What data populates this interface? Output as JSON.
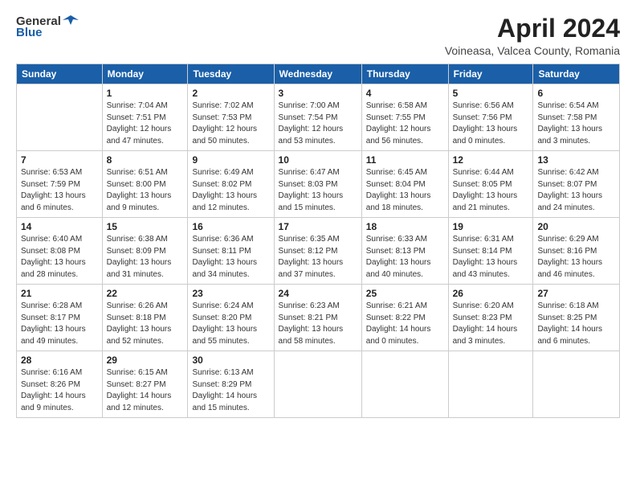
{
  "header": {
    "logo_general": "General",
    "logo_blue": "Blue",
    "title": "April 2024",
    "subtitle": "Voineasa, Valcea County, Romania"
  },
  "calendar": {
    "columns": [
      "Sunday",
      "Monday",
      "Tuesday",
      "Wednesday",
      "Thursday",
      "Friday",
      "Saturday"
    ],
    "weeks": [
      [
        {
          "day": "",
          "info": ""
        },
        {
          "day": "1",
          "info": "Sunrise: 7:04 AM\nSunset: 7:51 PM\nDaylight: 12 hours\nand 47 minutes."
        },
        {
          "day": "2",
          "info": "Sunrise: 7:02 AM\nSunset: 7:53 PM\nDaylight: 12 hours\nand 50 minutes."
        },
        {
          "day": "3",
          "info": "Sunrise: 7:00 AM\nSunset: 7:54 PM\nDaylight: 12 hours\nand 53 minutes."
        },
        {
          "day": "4",
          "info": "Sunrise: 6:58 AM\nSunset: 7:55 PM\nDaylight: 12 hours\nand 56 minutes."
        },
        {
          "day": "5",
          "info": "Sunrise: 6:56 AM\nSunset: 7:56 PM\nDaylight: 13 hours\nand 0 minutes."
        },
        {
          "day": "6",
          "info": "Sunrise: 6:54 AM\nSunset: 7:58 PM\nDaylight: 13 hours\nand 3 minutes."
        }
      ],
      [
        {
          "day": "7",
          "info": "Sunrise: 6:53 AM\nSunset: 7:59 PM\nDaylight: 13 hours\nand 6 minutes."
        },
        {
          "day": "8",
          "info": "Sunrise: 6:51 AM\nSunset: 8:00 PM\nDaylight: 13 hours\nand 9 minutes."
        },
        {
          "day": "9",
          "info": "Sunrise: 6:49 AM\nSunset: 8:02 PM\nDaylight: 13 hours\nand 12 minutes."
        },
        {
          "day": "10",
          "info": "Sunrise: 6:47 AM\nSunset: 8:03 PM\nDaylight: 13 hours\nand 15 minutes."
        },
        {
          "day": "11",
          "info": "Sunrise: 6:45 AM\nSunset: 8:04 PM\nDaylight: 13 hours\nand 18 minutes."
        },
        {
          "day": "12",
          "info": "Sunrise: 6:44 AM\nSunset: 8:05 PM\nDaylight: 13 hours\nand 21 minutes."
        },
        {
          "day": "13",
          "info": "Sunrise: 6:42 AM\nSunset: 8:07 PM\nDaylight: 13 hours\nand 24 minutes."
        }
      ],
      [
        {
          "day": "14",
          "info": "Sunrise: 6:40 AM\nSunset: 8:08 PM\nDaylight: 13 hours\nand 28 minutes."
        },
        {
          "day": "15",
          "info": "Sunrise: 6:38 AM\nSunset: 8:09 PM\nDaylight: 13 hours\nand 31 minutes."
        },
        {
          "day": "16",
          "info": "Sunrise: 6:36 AM\nSunset: 8:11 PM\nDaylight: 13 hours\nand 34 minutes."
        },
        {
          "day": "17",
          "info": "Sunrise: 6:35 AM\nSunset: 8:12 PM\nDaylight: 13 hours\nand 37 minutes."
        },
        {
          "day": "18",
          "info": "Sunrise: 6:33 AM\nSunset: 8:13 PM\nDaylight: 13 hours\nand 40 minutes."
        },
        {
          "day": "19",
          "info": "Sunrise: 6:31 AM\nSunset: 8:14 PM\nDaylight: 13 hours\nand 43 minutes."
        },
        {
          "day": "20",
          "info": "Sunrise: 6:29 AM\nSunset: 8:16 PM\nDaylight: 13 hours\nand 46 minutes."
        }
      ],
      [
        {
          "day": "21",
          "info": "Sunrise: 6:28 AM\nSunset: 8:17 PM\nDaylight: 13 hours\nand 49 minutes."
        },
        {
          "day": "22",
          "info": "Sunrise: 6:26 AM\nSunset: 8:18 PM\nDaylight: 13 hours\nand 52 minutes."
        },
        {
          "day": "23",
          "info": "Sunrise: 6:24 AM\nSunset: 8:20 PM\nDaylight: 13 hours\nand 55 minutes."
        },
        {
          "day": "24",
          "info": "Sunrise: 6:23 AM\nSunset: 8:21 PM\nDaylight: 13 hours\nand 58 minutes."
        },
        {
          "day": "25",
          "info": "Sunrise: 6:21 AM\nSunset: 8:22 PM\nDaylight: 14 hours\nand 0 minutes."
        },
        {
          "day": "26",
          "info": "Sunrise: 6:20 AM\nSunset: 8:23 PM\nDaylight: 14 hours\nand 3 minutes."
        },
        {
          "day": "27",
          "info": "Sunrise: 6:18 AM\nSunset: 8:25 PM\nDaylight: 14 hours\nand 6 minutes."
        }
      ],
      [
        {
          "day": "28",
          "info": "Sunrise: 6:16 AM\nSunset: 8:26 PM\nDaylight: 14 hours\nand 9 minutes."
        },
        {
          "day": "29",
          "info": "Sunrise: 6:15 AM\nSunset: 8:27 PM\nDaylight: 14 hours\nand 12 minutes."
        },
        {
          "day": "30",
          "info": "Sunrise: 6:13 AM\nSunset: 8:29 PM\nDaylight: 14 hours\nand 15 minutes."
        },
        {
          "day": "",
          "info": ""
        },
        {
          "day": "",
          "info": ""
        },
        {
          "day": "",
          "info": ""
        },
        {
          "day": "",
          "info": ""
        }
      ]
    ]
  }
}
